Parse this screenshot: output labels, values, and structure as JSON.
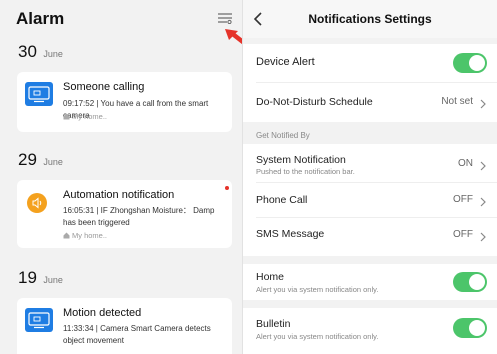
{
  "alarm": {
    "title": "Alarm",
    "groups": [
      {
        "day": "30",
        "month": "June",
        "item": {
          "title": "Someone calling",
          "description": "09:17:52 | You have a call from the smart camera",
          "home": "My home..",
          "icon": "camera-device-icon",
          "unread": false
        }
      },
      {
        "day": "29",
        "month": "June",
        "item": {
          "title": "Automation notification",
          "description": "16:05:31 | IF Zhongshan Moisture： Damp has been triggered",
          "home": "My home..",
          "icon": "speaker-icon",
          "unread": true
        }
      },
      {
        "day": "19",
        "month": "June",
        "item": {
          "title": "Motion detected",
          "description": "11:33:34 | Camera Smart Camera detects object movement",
          "home": "",
          "icon": "camera-device-icon",
          "unread": false
        }
      }
    ]
  },
  "settings": {
    "title": "Notifications Settings",
    "device_alert": {
      "label": "Device Alert",
      "enabled": true
    },
    "dnd": {
      "label": "Do-Not-Disturb Schedule",
      "value": "Not set"
    },
    "section_label": "Get Notified By",
    "system_notification": {
      "label": "System Notification",
      "sub": "Pushed to the notification bar.",
      "value": "ON"
    },
    "phone_call": {
      "label": "Phone Call",
      "value": "OFF"
    },
    "sms": {
      "label": "SMS Message",
      "value": "OFF"
    },
    "home": {
      "label": "Home",
      "sub": "Alert you via system notification only.",
      "enabled": true
    },
    "bulletin": {
      "label": "Bulletin",
      "sub": "Alert you via system notification only.",
      "enabled": true
    }
  },
  "colors": {
    "toggle_on": "#4cc56a",
    "device_icon_blue": "#1f7de3",
    "automation_icon_orange": "#f4a11e",
    "unread_dot": "#e5332a",
    "annotation_arrow": "#e5332a"
  }
}
